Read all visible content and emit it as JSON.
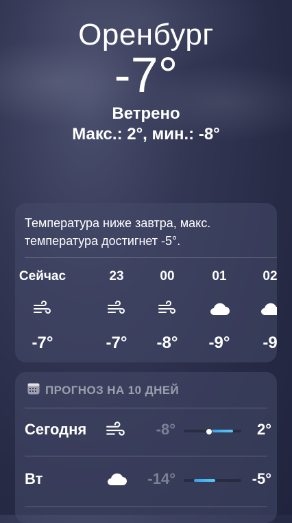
{
  "header": {
    "city": "Оренбург",
    "temperature": "-7°",
    "condition": "Ветрено",
    "high_low": "Макс.: 2°, мин.: -8°"
  },
  "hourly": {
    "summary": "Температура ниже завтра, макс. температура достигнет -5°.",
    "items": [
      {
        "time": "Сейчас",
        "icon": "wind-icon",
        "temp": "-7°"
      },
      {
        "time": "23",
        "icon": "wind-icon",
        "temp": "-7°"
      },
      {
        "time": "00",
        "icon": "wind-icon",
        "temp": "-8°"
      },
      {
        "time": "01",
        "icon": "cloud-icon",
        "temp": "-9°"
      },
      {
        "time": "02",
        "icon": "cloud-icon",
        "temp": "-9"
      }
    ]
  },
  "daily": {
    "title": "ПРОГНОЗ НА 10 ДНЕЙ",
    "icon": "calendar-icon",
    "days": [
      {
        "name": "Сегодня",
        "icon": "wind-icon",
        "low": "-8°",
        "high": "2°",
        "range_start": 0.44,
        "range_end": 0.86,
        "current": 0.44
      },
      {
        "name": "Вт",
        "icon": "cloud-icon",
        "low": "-14°",
        "high": "-5°",
        "range_start": 0.18,
        "range_end": 0.55
      }
    ]
  },
  "colors": {
    "background": "#2b2f4a",
    "card": "#464a69",
    "range_bar": "#4cb8f0"
  }
}
